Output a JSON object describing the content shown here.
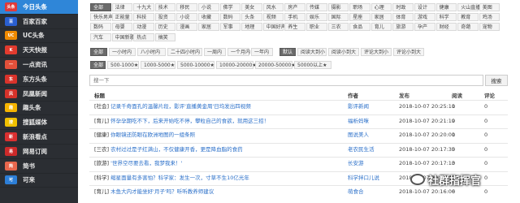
{
  "sidebar": {
    "items": [
      {
        "label": "今日头条",
        "icon": "toutiao-icon",
        "color": "#e03a3a",
        "icon_text": "头条"
      },
      {
        "label": "百家百家",
        "icon": "baijia-icon",
        "color": "#2a5fd0",
        "icon_text": "百"
      },
      {
        "label": "UC头条",
        "icon": "uc-icon",
        "color": "#f08a00",
        "icon_text": "UC"
      },
      {
        "label": "天天快报",
        "icon": "kuaibao-icon",
        "color": "#e23b2e",
        "icon_text": "K"
      },
      {
        "label": "一点资讯",
        "icon": "yidian-icon",
        "color": "#e2503a",
        "icon_text": "一"
      },
      {
        "label": "东方头条",
        "icon": "dongfang-icon",
        "color": "#d9332b",
        "icon_text": "东"
      },
      {
        "label": "凤凰新闻",
        "icon": "fenghuang-icon",
        "color": "#d6322a",
        "icon_text": "凤"
      },
      {
        "label": "趣头条",
        "icon": "qutoutiao-icon",
        "color": "#f5b400",
        "icon_text": "趣"
      },
      {
        "label": "搜狐媒体",
        "icon": "sohu-icon",
        "color": "#f0c000",
        "icon_text": "搜"
      },
      {
        "label": "新浪看点",
        "icon": "sina-icon",
        "color": "#d93030",
        "icon_text": "新"
      },
      {
        "label": "网易订阅",
        "icon": "netease-icon",
        "color": "#cc2a2a",
        "icon_text": "易"
      },
      {
        "label": "简书",
        "icon": "jianshu-icon",
        "color": "#e8674d",
        "icon_text": "简"
      },
      {
        "label": "可来",
        "icon": "kelai-icon",
        "color": "#2d7fd8",
        "icon_text": "可"
      }
    ]
  },
  "categories": {
    "rows": [
      [
        "全部",
        "法律",
        "十九大",
        "技术",
        "移民",
        "小说",
        "佛学",
        "美女",
        "风水",
        "房产",
        "传媒",
        "摄影",
        "职场",
        "心理",
        "时政",
        "设计",
        "健康",
        "火山直播",
        "美图"
      ],
      [
        "快乐男声",
        "正能量",
        "科技",
        "投资",
        "小说",
        "收藏",
        "数码",
        "头条",
        "视频",
        "手机",
        "娱乐",
        "国际",
        "星座",
        "家居",
        "体育",
        "游戏",
        "科学",
        "教育",
        "鸡汤"
      ],
      [
        "数码",
        "母婴",
        "动漫",
        "历史",
        "漫画",
        "家居",
        "军事",
        "地理",
        "中国好声音",
        "养生",
        "职业",
        "三农",
        "食品",
        "育儿",
        "旅游",
        "孕产",
        "财经",
        "奇葩",
        "宠物"
      ],
      [
        "汽车",
        "中国新歌声",
        "热点",
        "搞笑"
      ]
    ],
    "selected": "全部"
  },
  "time_filters": {
    "items": [
      "全部",
      "一小时内",
      "八小时内",
      "二十四小时内",
      "一周内",
      "一个月内",
      "一年内"
    ],
    "selected": "全部"
  },
  "sort_filters": {
    "items": [
      "默认",
      "阅读大到小",
      "阅读小到大",
      "评论大到小",
      "评论小到大"
    ],
    "selected": "默认"
  },
  "read_filters": {
    "items": [
      "全部",
      "500-1000★",
      "1000-5000★",
      "5000-10000★",
      "10000-20000★",
      "20000-50000★",
      "50000以上★"
    ],
    "selected": "全部"
  },
  "search": {
    "placeholder": "搜一下",
    "button": "搜索"
  },
  "table": {
    "headers": {
      "title": "标题",
      "author": "作者",
      "publish": "发布",
      "read": "阅读",
      "comment": "评论"
    },
    "rows": [
      {
        "prefix": "[社会]",
        "title": "记录千奇面孔的温馨片段，影评'直播黄金周'日均发出四视频",
        "author": "影评新闻",
        "date": "2018-10-07 20:25:11",
        "read": "0",
        "comment": "0"
      },
      {
        "prefix": "[育儿]",
        "title": "怀孕孕期吃不下，后来开始吃不停，攀粒自己的食欲，就用这三招！",
        "author": "福析妈咪",
        "date": "2018-10-07 20:21:19",
        "read": "0",
        "comment": "0"
      },
      {
        "prefix": "[健康]",
        "title": "你眼镜还防眼在欧洲地图的一组条照",
        "author": "图说美人",
        "date": "2018-10-07 20:20:01",
        "read": "0",
        "comment": "0"
      },
      {
        "prefix": "[三农]",
        "title": "农村过过是子红满山，不仅健康开香，更是降血脂的食药",
        "author": "老农民生活",
        "date": "2018-10-07 20:17:35",
        "read": "0",
        "comment": "0"
      },
      {
        "prefix": "[旅游]",
        "title": "'世界空尽要去看，我梦我来！'",
        "author": "长安游",
        "date": "2018-10-07 20:17:13",
        "read": "0",
        "comment": "0"
      },
      {
        "prefix": "[科学]",
        "title": "缩星面量有多害怕？科学家：发生一次，寸草不生10亿光年",
        "author": "科学拌口儿说",
        "date": "2018-10-07 20:16:49",
        "read": "0",
        "comment": "0"
      },
      {
        "prefix": "[育儿]",
        "title": "木鱼大内才能坐好'月子'吗？听听教养师建议",
        "author": "萌食合",
        "date": "2018-10-07 20:16:06",
        "read": "0",
        "comment": "0"
      }
    ]
  },
  "watermark": {
    "text": "社群指挥官"
  }
}
